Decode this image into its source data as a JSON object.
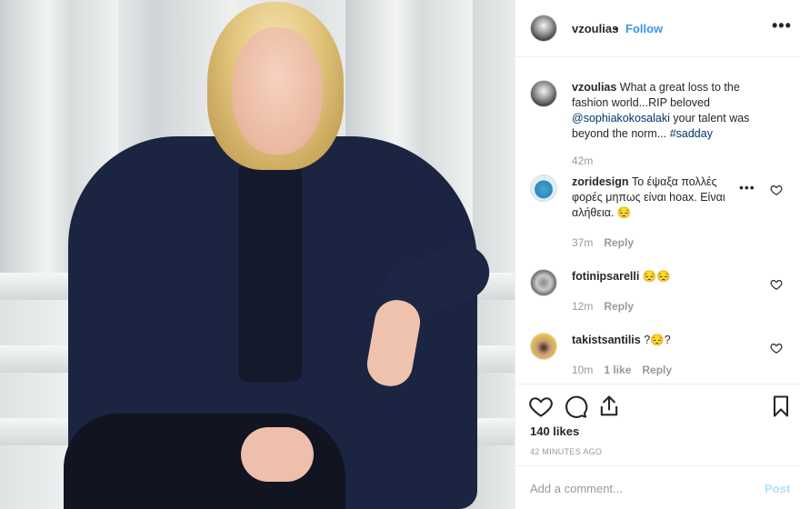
{
  "header": {
    "username": "vzoulias",
    "dot": "•",
    "follow_label": "Follow",
    "more_icon": "more-horizontal-icon",
    "more_glyph": "•••"
  },
  "caption": {
    "username": "vzoulias",
    "text_1": " What a great loss to the fashion world...RIP beloved ",
    "mention": "@sophiakokosalaki",
    "text_2": " your talent was beyond the norm... ",
    "hashtag": "#sadday",
    "time": "42m"
  },
  "comments": [
    {
      "username": "zoridesign",
      "text": " Το έψαξα πολλές φορές μηπως είναι hoax. Είναι αλήθεια. 😔",
      "time": "37m",
      "reply": "Reply"
    },
    {
      "username": "fotinipsarelli",
      "text": " 😔😔",
      "time": "12m",
      "reply": "Reply"
    },
    {
      "username": "takistsantilis",
      "text": " ?😔?",
      "time": "10m",
      "likes": "1 like",
      "reply": "Reply"
    }
  ],
  "actions": {
    "likes": "140 likes",
    "time_ago": "42 MINUTES AGO"
  },
  "add_comment": {
    "placeholder": "Add a comment...",
    "post_label": "Post"
  },
  "colors": {
    "accent": "#3897f0",
    "link": "#003569",
    "muted": "#999999",
    "post_disabled": "#b2dffc"
  }
}
